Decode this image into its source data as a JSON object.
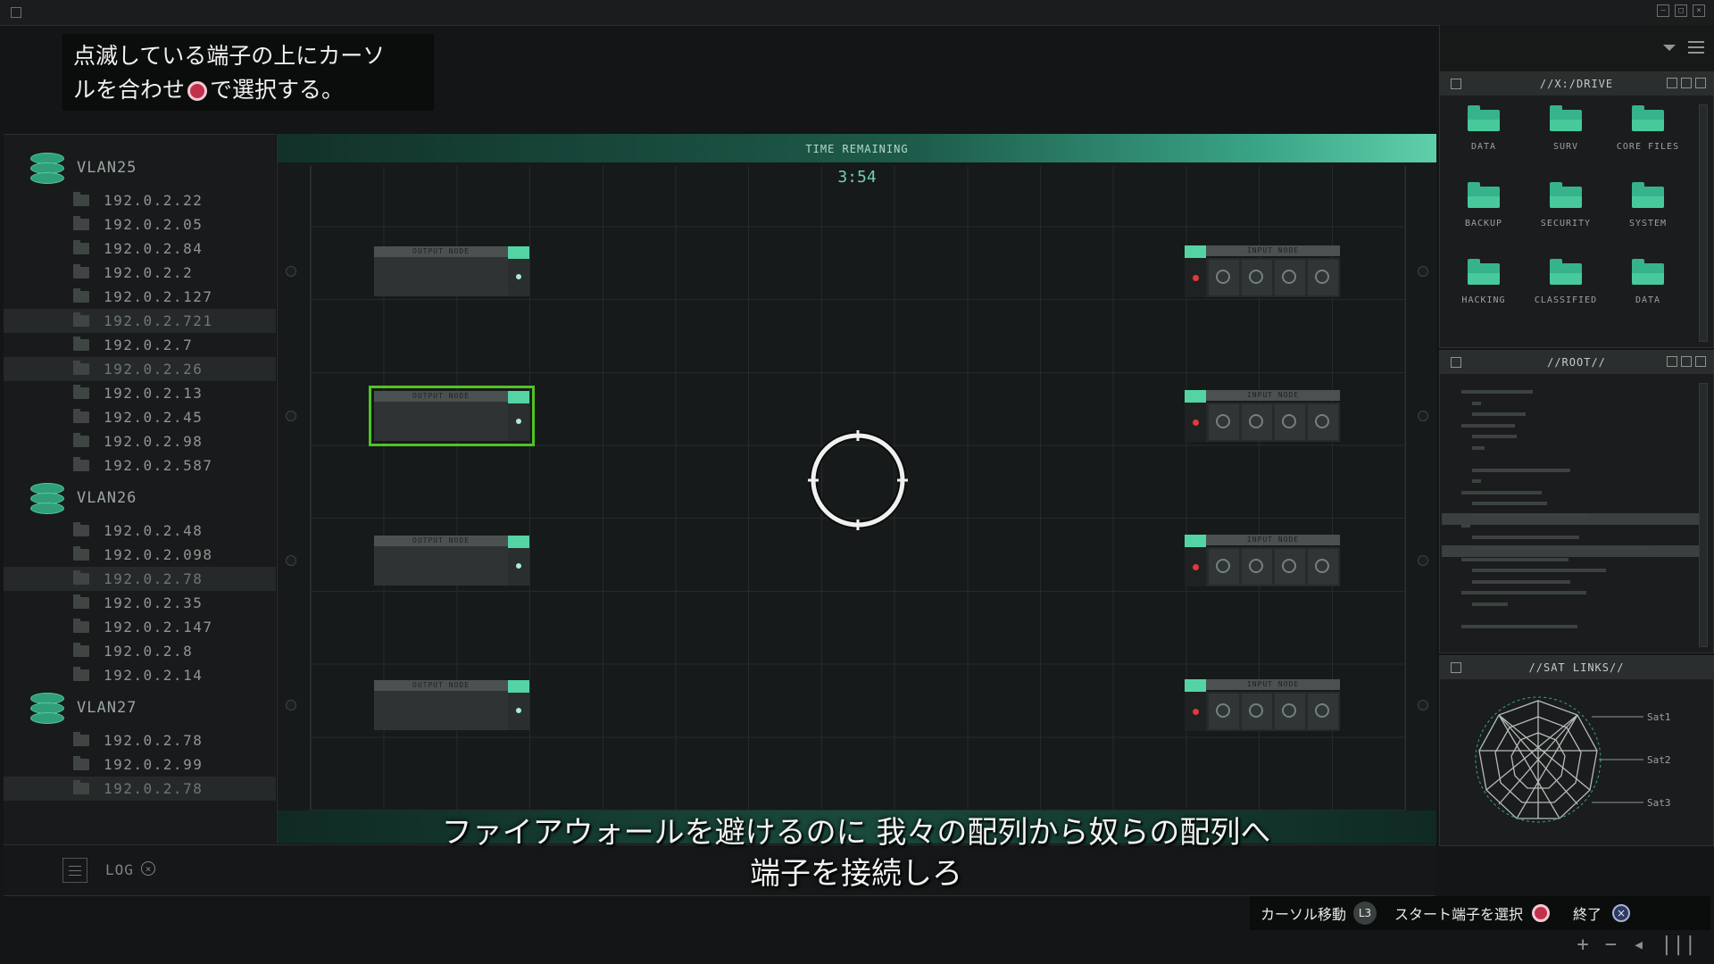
{
  "hint": {
    "line1": "点滅している端子の上にカーソ",
    "line2_a": "ルを合わせ",
    "line2_b": "で選択する。"
  },
  "sidebar": {
    "groups": [
      {
        "name": "VLAN25",
        "ips": [
          "192.0.2.22",
          "192.0.2.05",
          "192.0.2.84",
          "192.0.2.2",
          "192.0.2.127",
          "192.0.2.721",
          "192.0.2.7",
          "192.0.2.26",
          "192.0.2.13",
          "192.0.2.45",
          "192.0.2.98",
          "192.0.2.587"
        ],
        "highlighted": [
          5,
          7
        ]
      },
      {
        "name": "VLAN26",
        "ips": [
          "192.0.2.48",
          "192.0.2.098",
          "192.0.2.78",
          "192.0.2.35",
          "192.0.2.147",
          "192.0.2.8",
          "192.0.2.14"
        ],
        "highlighted": [
          2
        ]
      },
      {
        "name": "VLAN27",
        "ips": [
          "192.0.2.78",
          "192.0.2.99",
          "192.0.2.78"
        ],
        "highlighted": [
          2
        ]
      }
    ]
  },
  "log": {
    "label": "LOG"
  },
  "game": {
    "timer_label": "TIME REMAINING",
    "timer_value": "3:54",
    "output_node_label": "OUTPUT NODE",
    "input_node_label": "INPUT NODE",
    "selected_output_index": 1
  },
  "subtitle": {
    "line1": "ファイアウォールを避けるのに 我々の配列から奴らの配列へ",
    "line2": "端子を接続しろ"
  },
  "drive": {
    "title": "//X:/DRIVE",
    "folders": [
      "DATA",
      "SURV",
      "CORE FILES",
      "BACKUP",
      "SECURITY",
      "SYSTEM",
      "HACKING",
      "CLASSIFIED",
      "DATA"
    ]
  },
  "root": {
    "title": "//ROOT//"
  },
  "sat": {
    "title": "//SAT LINKS//",
    "labels": [
      "Sat1",
      "Sat2",
      "Sat3"
    ]
  },
  "controls": {
    "move": "カーソル移動",
    "move_btn": "L3",
    "select": "スタート端子を選択",
    "quit": "終了"
  },
  "colors": {
    "accent": "#54d4a4",
    "selected_outline": "#4fc425",
    "input_dot": "#e2383f"
  }
}
